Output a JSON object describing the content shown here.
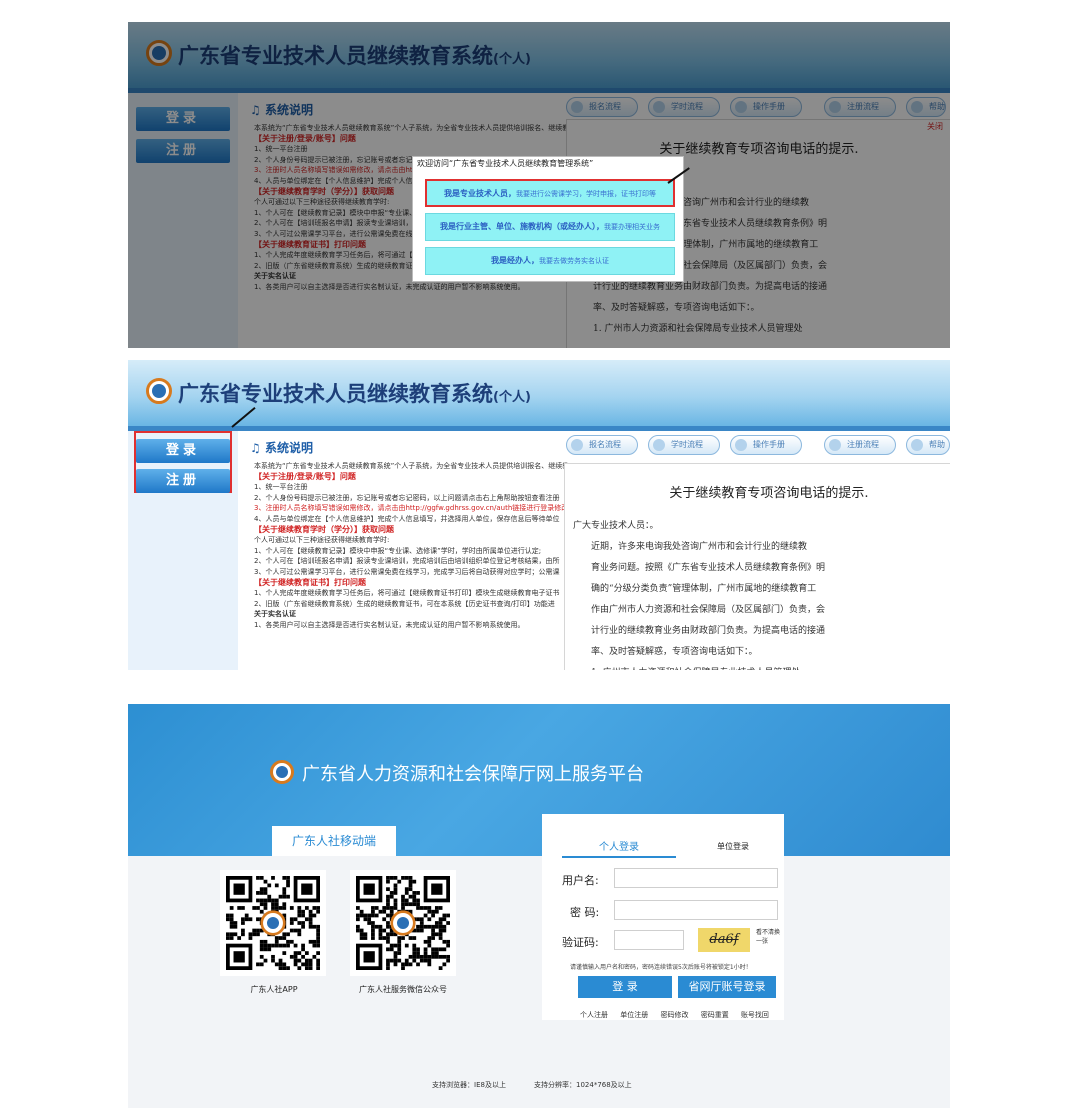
{
  "system": {
    "title": "广东省专业技术人员继续教育系统",
    "title_suffix": "(个人)",
    "nav_login": "登录",
    "nav_register": "注册",
    "section_heading": "系统说明",
    "tabs": [
      "报名流程",
      "学时流程",
      "操作手册",
      "注册流程",
      "帮助"
    ],
    "doc_lines": [
      {
        "text": "本系统为“广东省专业技术人员继续教育系统”个人子系统，为全省专业技术人员提供培训报名、继续教",
        "style": "normal"
      },
      {
        "text": "【关于注册/登录/账号】问题",
        "style": "red"
      },
      {
        "text": "1、统一平台注册",
        "style": "normal"
      },
      {
        "text": "2、个人身份号码提示已被注册，忘记账号或者忘记密码，以上问题请点击右上角帮助按钮查看注册",
        "style": "normal"
      },
      {
        "text": "3、注册时人员名称填写错误如需修改，请点击由http://ggfw.gdhrss.gov.cn/auth链接进行登录修改【修",
        "style": "rtxt"
      },
      {
        "text": "4、人员与单位绑定在【个人信息维护】完成个人信息填写，并选择用人单位，保存信息后等待单位",
        "style": "normal"
      },
      {
        "text": "【关于继续教育学时（学分）】获取问题",
        "style": "red"
      },
      {
        "text": "个人可通过以下三种途径获得继续教育学时:",
        "style": "normal"
      },
      {
        "text": "1、个人可在【继续教育记录】模块中申报“专业课、选修课”学时，学时由所属单位进行认定;",
        "style": "normal"
      },
      {
        "text": "2、个人可在【培训班报名申请】报读专业课培训，完成培训后由培训组织单位登记考核结果，由所",
        "style": "normal"
      },
      {
        "text": "3、个人可过公需课学习平台，进行公需课免费在线学习，完成学习后将自动获得对应学时；公需课",
        "style": "normal"
      },
      {
        "text": "【关于继续教育证书】打印问题",
        "style": "red"
      },
      {
        "text": "1、个人完成年度继续教育学习任务后，将可通过【继续教育证书打印】模块生成继续教育电子证书",
        "style": "normal"
      },
      {
        "text": "2、旧版（广东省继续教育系统）生成的继续教育证书，可在本系统【历史证书查询/打印】功能进",
        "style": "normal"
      },
      {
        "text": "关于实名认证",
        "style": "bold"
      },
      {
        "text": "1、各类用户可以自主选择是否进行实名制认证，未完成认证的用户暂不影响系统使用。",
        "style": "normal"
      }
    ],
    "notice": {
      "close": "关闭",
      "title": "关于继续教育专项咨询电话的提示.",
      "lines": [
        "广大专业技术人员：。",
        "近期，许多来电询我处咨询广州市和会计行业的继续教",
        "育业务问题。按照《广东省专业技术人员继续教育条例》明",
        "确的“分级分类负责”管理体制，广州市属地的继续教育工",
        "作由广州市人力资源和社会保障局（及区属部门）负责，会",
        "计行业的继续教育业务由财政部门负责。为提高电话的接通",
        "率、及时答疑解惑，专项咨询电话如下：。",
        "1. 广州市人力资源和社会保障局专业技术人员管理处"
      ]
    }
  },
  "dialog": {
    "title": "欢迎访问“广东省专业技术人员继续教育管理系统”",
    "options": [
      {
        "bold": "我是专业技术人员，",
        "text": "我要进行公需课学习，学时申报，证书打印等"
      },
      {
        "bold": "我是行业主管、单位、施教机构（或经办人），",
        "text": "我要办理相关业务"
      },
      {
        "bold": "我是经办人，",
        "text": "我要去做劳务实名认证"
      }
    ]
  },
  "portal": {
    "title": "广东省人力资源和社会保障厅网上服务平台",
    "mobile_tab": "广东人社移动端",
    "qr_captions": [
      "广东人社APP",
      "广东人社服务微信公众号"
    ],
    "login": {
      "tab_personal": "个人登录",
      "tab_unit": "单位登录",
      "username_label": "用户名:",
      "password_label": "密  码:",
      "captcha_label": "验证码:",
      "captcha_text": "da6f",
      "cant_see": "看不清换一张",
      "hint": "请谨慎输入用户名和密码，密码连续错误5次后账号将被锁定1小时！",
      "login_button": "登  录",
      "province_button": "省网厅账号登录",
      "links": [
        "个人注册",
        "单位注册",
        "密码修改",
        "密码重置",
        "账号找回"
      ]
    },
    "support_browser": "支持浏览器：IE8及以上",
    "support_resolution": "支持分辨率：1024*768及以上"
  },
  "colors": {
    "accent_blue": "#2a8bd3",
    "highlight_red": "#e03030",
    "option_cyan": "#8ff2f5",
    "nav_blue": "#1f78c8"
  }
}
